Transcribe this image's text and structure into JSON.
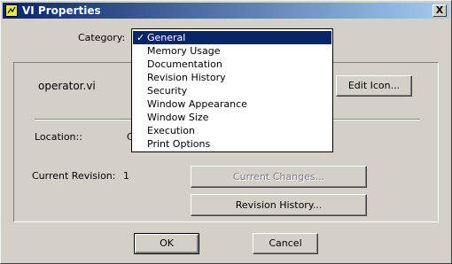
{
  "window": {
    "title": "VI Properties",
    "close_label": "X"
  },
  "category": {
    "label": "Category:",
    "options": [
      "General",
      "Memory Usage",
      "Documentation",
      "Revision History",
      "Security",
      "Window Appearance",
      "Window Size",
      "Execution",
      "Print Options"
    ],
    "selected_index": 0,
    "check_mark": "✓"
  },
  "general": {
    "vi_name": "operator.vi",
    "edit_icon_label": "Edit Icon...",
    "location_label": "Location::",
    "location_value_partial": "C",
    "current_revision_label": "Current Revision:",
    "current_revision_value": "1",
    "current_changes_label": "Current Changes...",
    "revision_history_label": "Revision History..."
  },
  "footer": {
    "ok_label": "OK",
    "cancel_label": "Cancel"
  }
}
